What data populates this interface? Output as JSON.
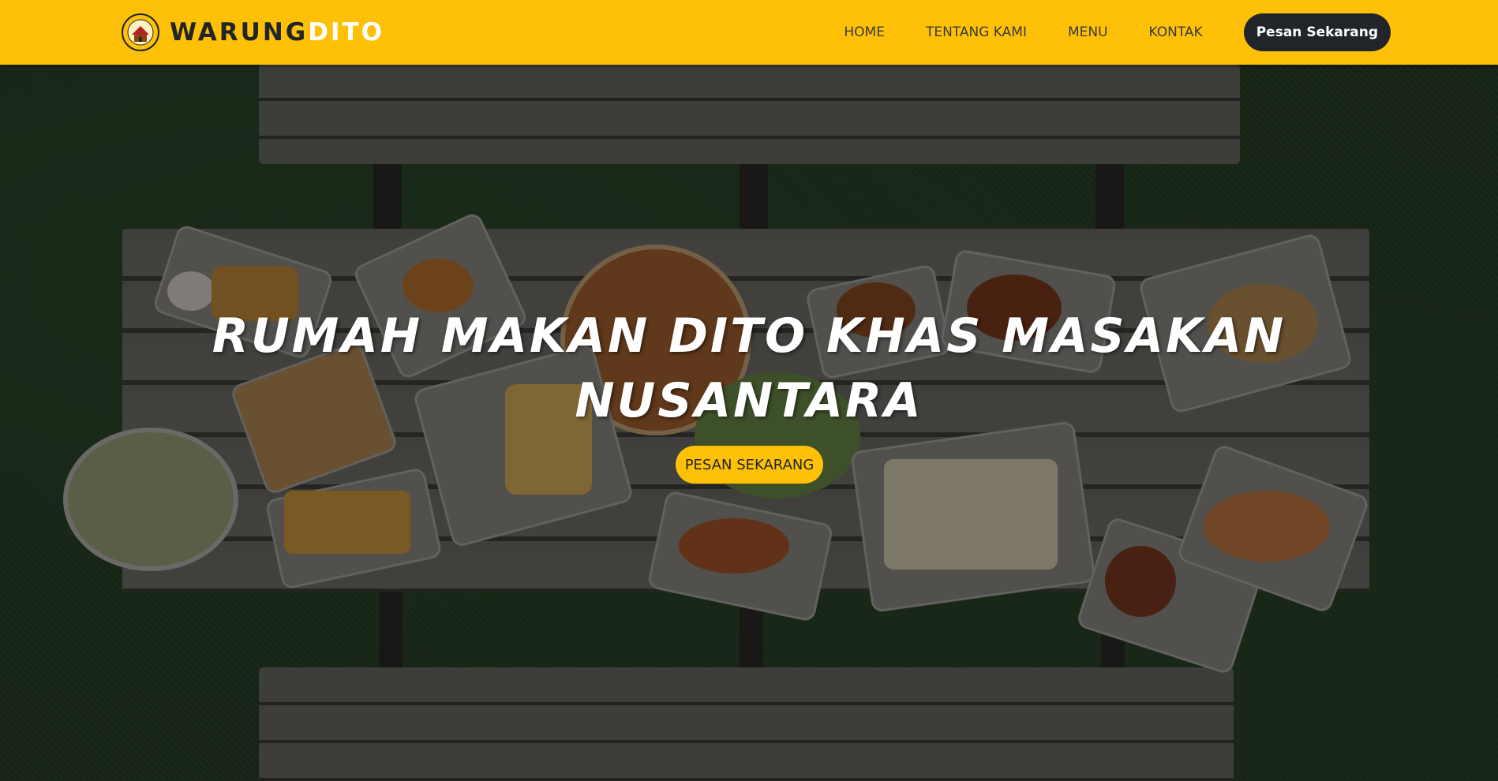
{
  "brand": {
    "name_part1": "WARUNG",
    "name_part2": "DITO",
    "logo_icon": "restaurant-logo-icon"
  },
  "nav": {
    "items": [
      {
        "label": "HOME"
      },
      {
        "label": "TENTANG KAMI"
      },
      {
        "label": "MENU"
      },
      {
        "label": "KONTAK"
      }
    ],
    "cta_label": "Pesan Sekarang"
  },
  "hero": {
    "title": "RUMAH MAKAN DITO KHAS MASAKAN NUSANTARA",
    "cta_label": "PESAN SEKARANG",
    "background": "picnic-table-food-image"
  },
  "colors": {
    "accent": "#ffc107",
    "dark": "#212529",
    "white": "#ffffff"
  }
}
